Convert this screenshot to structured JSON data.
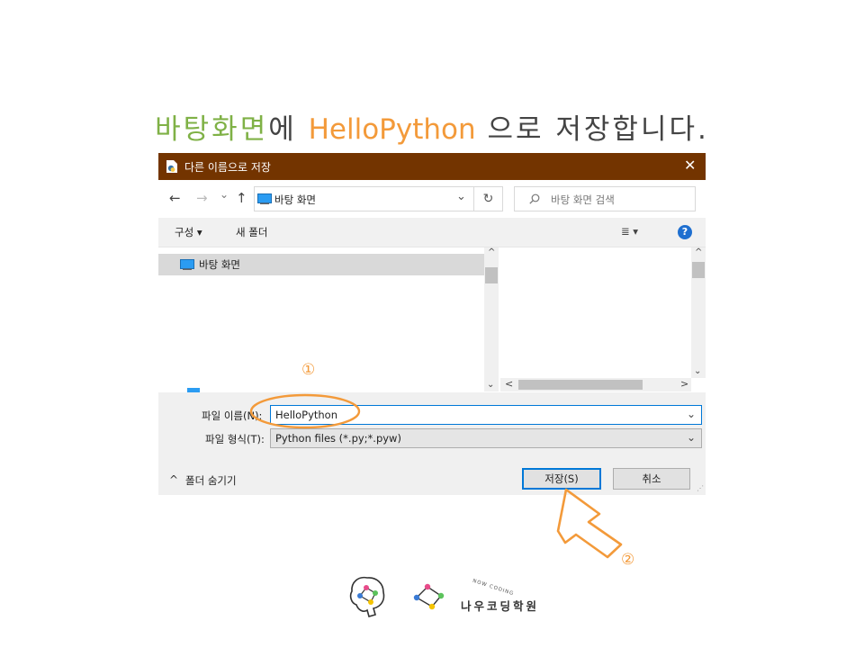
{
  "heading": {
    "part1": "바탕화면",
    "part2": "에 ",
    "part3": "HelloPython",
    "part4": " 으로 저장합니다."
  },
  "dialog": {
    "title": "다른 이름으로 저장",
    "close_glyph": "✕",
    "nav": {
      "back": "←",
      "forward": "→",
      "recent": "⌄",
      "up": "↑"
    },
    "address": "바탕 화면",
    "refresh_glyph": "↻",
    "search_placeholder": "바탕 화면 검색",
    "toolbar": {
      "organize": "구성 ▾",
      "new_folder": "새 폴더",
      "view_glyph": "≣ ▾",
      "help": "?"
    },
    "nav_pane_items": [
      "바탕 화면"
    ],
    "filename_label": "파일 이름(N):",
    "filename_value": "HelloPython",
    "filetype_label": "파일 형식(T):",
    "filetype_value": "Python files (*.py;*.pyw)",
    "hide_folders": "폴더 숨기기",
    "hide_folders_glyph": "^",
    "save_button": "저장(S)",
    "cancel_button": "취소"
  },
  "annotations": {
    "step1": "①",
    "step2": "②"
  },
  "logo": {
    "text": "나우코딩학원",
    "arc_text": "NOW CODING"
  },
  "colors": {
    "titlebar": "#733400",
    "accent_green": "#7fb146",
    "accent_orange": "#f39a3a",
    "select_blue": "#0078d7"
  }
}
